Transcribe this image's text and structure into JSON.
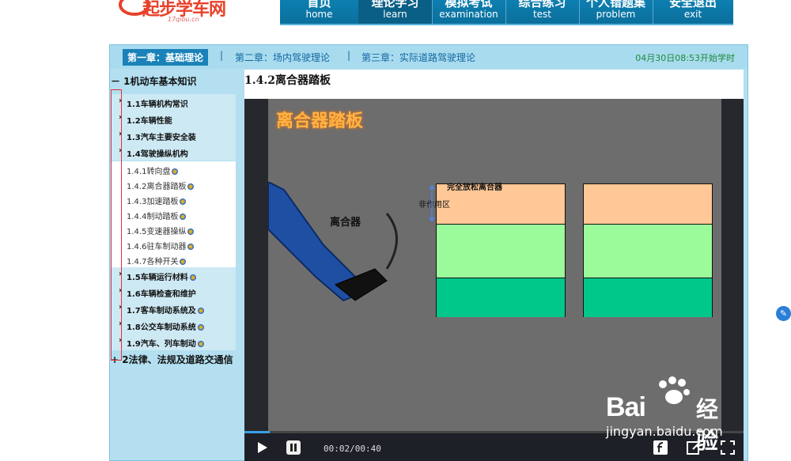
{
  "brand": {
    "logo_text": "起步学车网",
    "logo_sub": "17qibu.cn"
  },
  "nav": [
    {
      "zh": "首页",
      "en": "home"
    },
    {
      "zh": "理论学习",
      "en": "learn"
    },
    {
      "zh": "模拟考试",
      "en": "examination"
    },
    {
      "zh": "综合练习",
      "en": "test"
    },
    {
      "zh": "个人错题集",
      "en": "problem"
    },
    {
      "zh": "安全退出",
      "en": "exit"
    }
  ],
  "chapters": {
    "ch1": "第一章：基础理论",
    "ch2": "第二章：场内驾驶理论",
    "ch3": "第三章：实际道路驾驶理论",
    "sep": "|",
    "timer": "04月30日08:53开始学时"
  },
  "sidebar": {
    "section1": "－ 1机动车基本知识",
    "items": [
      {
        "arrow": "›",
        "label": "1.1车辆机构常识"
      },
      {
        "arrow": "›",
        "label": "1.2车辆性能"
      },
      {
        "arrow": "›",
        "label": "1.3汽车主要安全装"
      },
      {
        "arrow": "›",
        "label": "1.4驾驶操纵机构"
      }
    ],
    "lessons": [
      {
        "label": "1.4.1转向盘"
      },
      {
        "label": "1.4.2离合器踏板"
      },
      {
        "label": "1.4.3加速踏板"
      },
      {
        "label": "1.4.4制动踏板"
      },
      {
        "label": "1.4.5变速器操纵"
      },
      {
        "label": "1.4.6驻车制动器"
      },
      {
        "label": "1.4.7各种开关"
      }
    ],
    "items2": [
      {
        "arrow": "›",
        "label": "1.5车辆运行材料"
      },
      {
        "arrow": "›",
        "label": "1.6车辆检查和维护"
      },
      {
        "arrow": "›",
        "label": "1.7客车制动系统及"
      },
      {
        "arrow": "›",
        "label": "1.8公交车制动系统"
      },
      {
        "arrow": "›",
        "label": "1.9汽车、列车制动"
      }
    ],
    "section2": "+ 2法律、法规及道路交通信"
  },
  "content": {
    "title": "1.4.2离合器踏板",
    "video_title": "离合器踏板",
    "clutch_label": "离合器",
    "free_label": "完全放松离合器",
    "idle_label": "非作用区",
    "time": "00:02/00:40",
    "progress": 0.05
  },
  "watermark": {
    "logo": "Bai",
    "logo2": "经验",
    "url": "jingyan.baidu.com"
  },
  "colors": {
    "accent": "#1a82b8",
    "gauge_top": "#ffc896",
    "gauge_mid": "#9bfb9b",
    "gauge_bot": "#00c78a"
  }
}
